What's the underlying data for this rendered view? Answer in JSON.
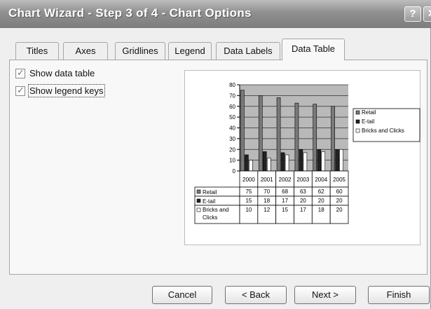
{
  "window": {
    "title": "Chart Wizard - Step 3 of 4 - Chart Options",
    "help_glyph": "?",
    "close_glyph": "✕"
  },
  "tabs": [
    {
      "label": "Titles"
    },
    {
      "label": "Axes"
    },
    {
      "label": "Gridlines"
    },
    {
      "label": "Legend"
    },
    {
      "label": "Data Labels"
    },
    {
      "label": "Data Table",
      "active": true
    }
  ],
  "options": {
    "show_data_table": {
      "label": "Show data table",
      "checked": true
    },
    "show_legend_keys": {
      "label": "Show legend keys",
      "checked": true
    }
  },
  "chart_data": {
    "type": "bar",
    "categories": [
      "2000",
      "2001",
      "2002",
      "2003",
      "2004",
      "2005"
    ],
    "series": [
      {
        "name": "Retail",
        "values": [
          75,
          70,
          68,
          63,
          62,
          60
        ],
        "color": "#7a7a7a"
      },
      {
        "name": "E-tail",
        "values": [
          15,
          18,
          17,
          20,
          20,
          20
        ],
        "color": "#222222"
      },
      {
        "name": "Bricks and Clicks",
        "values": [
          10,
          12,
          15,
          17,
          18,
          20
        ],
        "color": "#ffffff"
      }
    ],
    "ylim": [
      0,
      80
    ],
    "yticks": [
      "0",
      "10",
      "20",
      "30",
      "40",
      "50",
      "60",
      "70",
      "80"
    ],
    "table_row_labels": [
      "Retail",
      "E-tail",
      "Bricks and Clicks"
    ],
    "legend_position": "right",
    "grid": true
  },
  "buttons": {
    "cancel": "Cancel",
    "back": "< Back",
    "next": "Next >",
    "finish": "Finish"
  }
}
